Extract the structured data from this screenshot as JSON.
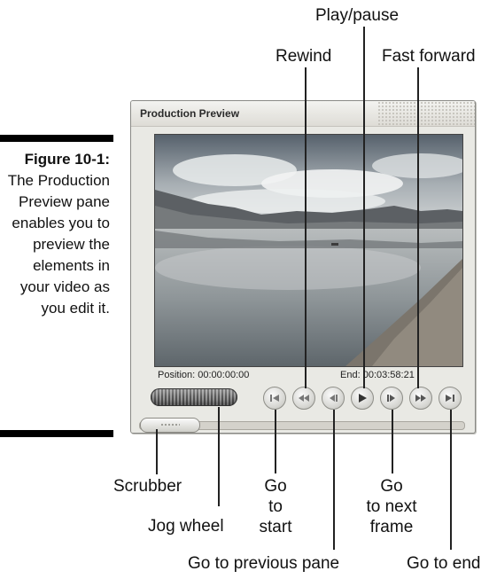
{
  "caption": {
    "figure_label": "Figure 10-1:",
    "text": "The Production Preview pane enables you to preview the elements in your video as you edit it."
  },
  "window": {
    "title": "Production Preview",
    "position_label": "Position:",
    "position_value": "00:00:00:00",
    "end_label": "End:",
    "end_value": "00:03:58:21"
  },
  "callouts": {
    "play_pause": "Play/pause",
    "rewind": "Rewind",
    "fast_forward": "Fast forward",
    "scrubber": "Scrubber",
    "go_to_start": "Go\nto\nstart",
    "go_to_next_frame": "Go\nto next\nframe",
    "jog_wheel": "Jog wheel",
    "go_to_previous_pane": "Go to previous pane",
    "go_to_end": "Go to end"
  },
  "buttons": [
    {
      "name": "go-to-start-button",
      "icon": "skip-start-icon"
    },
    {
      "name": "rewind-button",
      "icon": "rewind-icon"
    },
    {
      "name": "previous-frame-button",
      "icon": "previous-frame-icon"
    },
    {
      "name": "play-pause-button",
      "icon": "play-icon"
    },
    {
      "name": "next-frame-button",
      "icon": "next-frame-icon"
    },
    {
      "name": "fast-forward-button",
      "icon": "fast-forward-icon"
    },
    {
      "name": "go-to-end-button",
      "icon": "skip-end-icon"
    }
  ],
  "scrubber_position": 0
}
